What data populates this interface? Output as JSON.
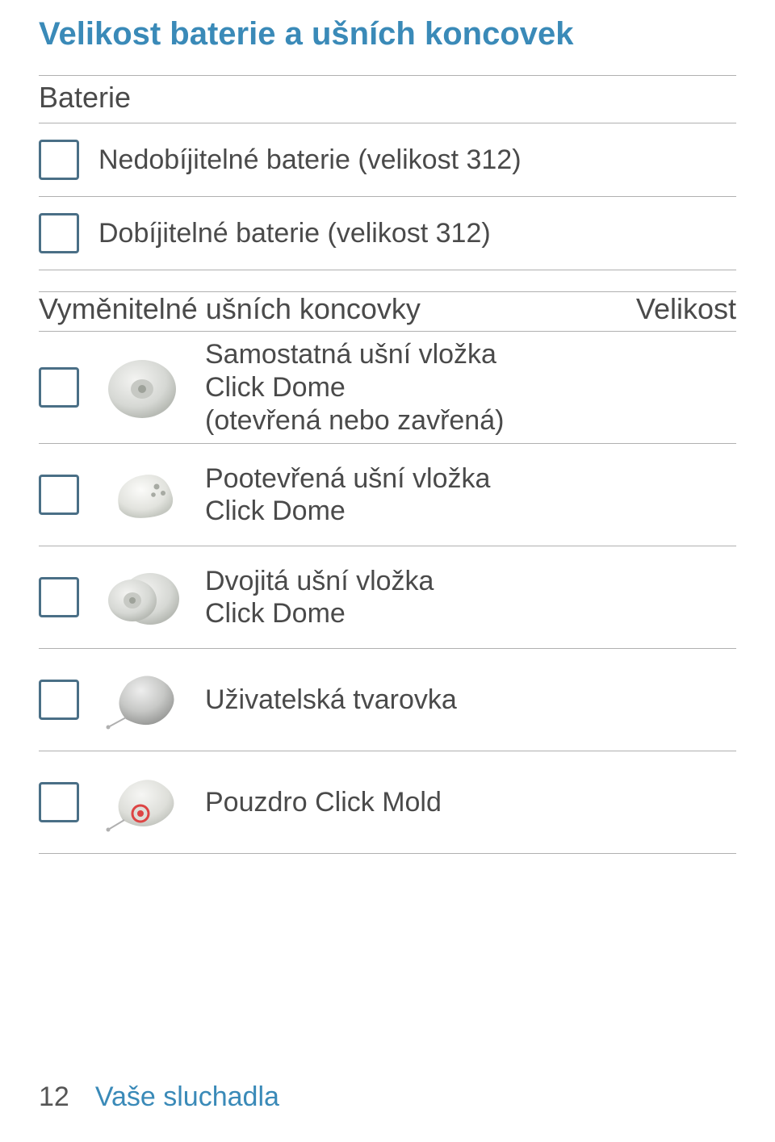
{
  "title": "Velikost baterie a ušních koncovek",
  "battery": {
    "heading": "Baterie",
    "items": [
      {
        "label": "Nedobíjitelné baterie (velikost 312)"
      },
      {
        "label": "Dobíjitelné baterie (velikost 312)"
      }
    ]
  },
  "eartips": {
    "heading_left": "Vyměnitelné ušních koncovky",
    "heading_right": "Velikost",
    "items": [
      {
        "label": "Samostatná ušní vložka\nClick Dome\n(otevřená nebo zavřená)",
        "icon": "dome-single"
      },
      {
        "label": "Pootevřená ušní vložka\nClick Dome",
        "icon": "dome-vented"
      },
      {
        "label": "Dvojitá ušní vložka\nClick Dome",
        "icon": "dome-double"
      },
      {
        "label": "Uživatelská tvarovka",
        "icon": "custom-mold"
      },
      {
        "label": "Pouzdro Click Mold",
        "icon": "click-mold"
      }
    ]
  },
  "footer": {
    "page": "12",
    "section": "Vaše sluchadla"
  }
}
